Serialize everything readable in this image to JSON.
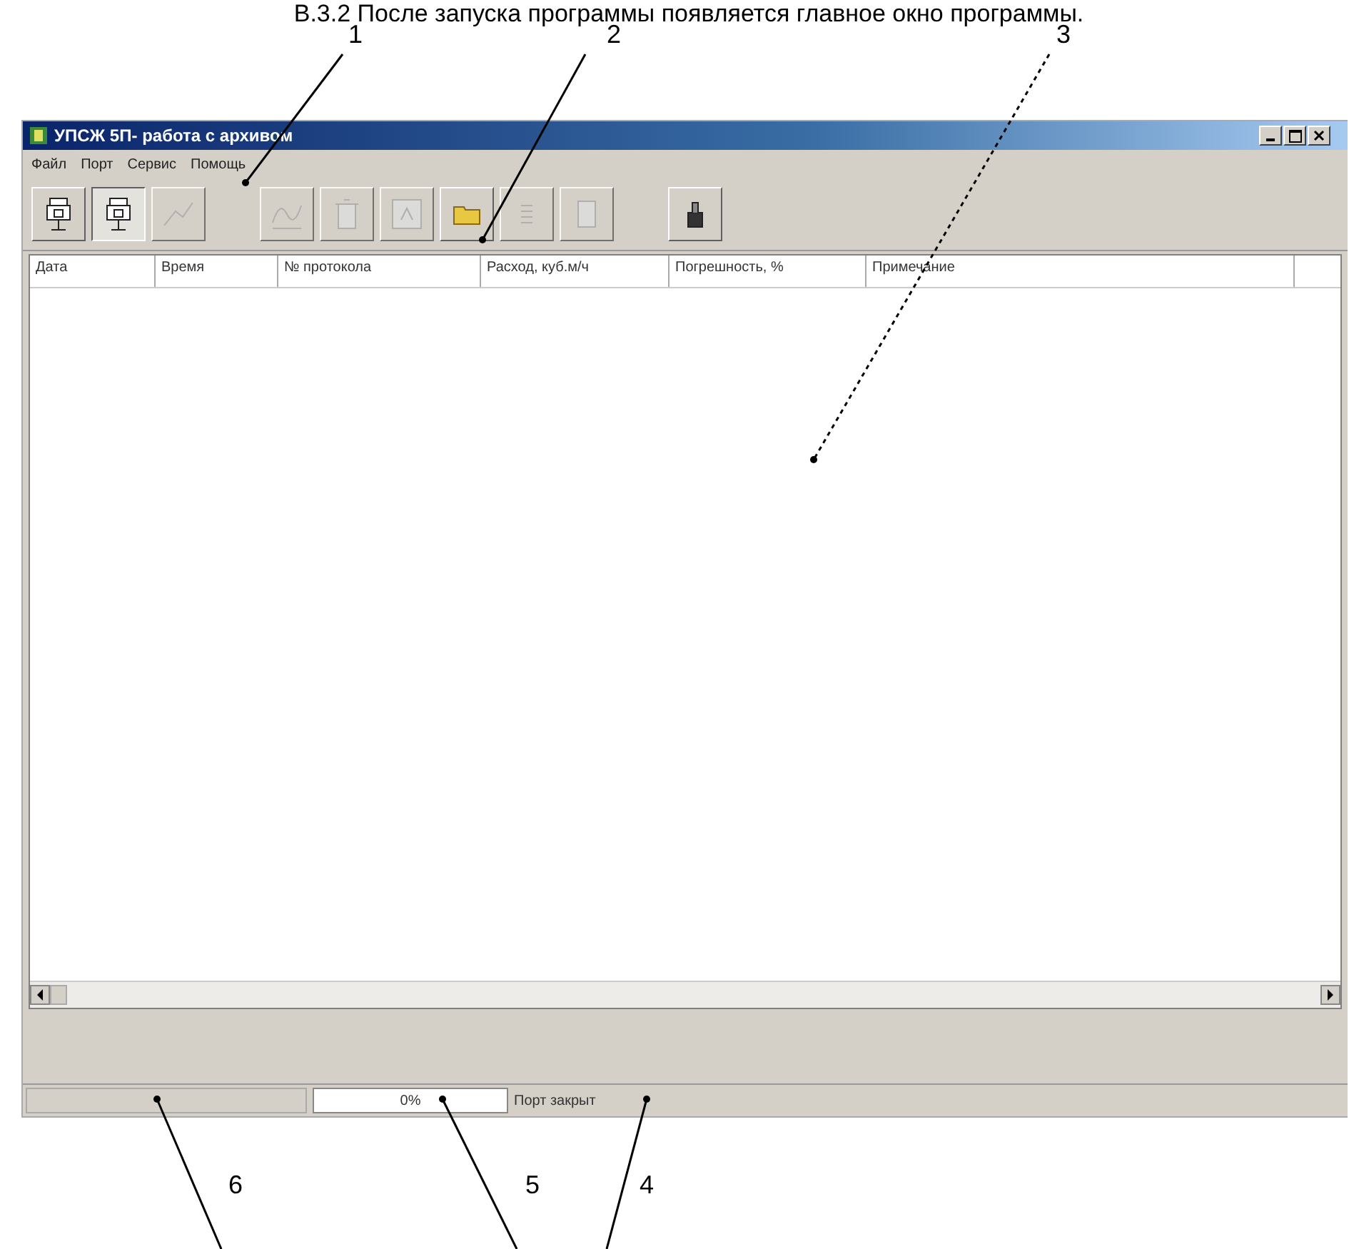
{
  "caption": "В.3.2 После запуска программы появляется главное окно программы.",
  "callouts": [
    {
      "number": "1",
      "kind": "solid"
    },
    {
      "number": "2",
      "kind": "solid"
    },
    {
      "number": "3",
      "kind": "dashed"
    },
    {
      "number": "6",
      "kind": "solid"
    },
    {
      "number": "5",
      "kind": "solid"
    },
    {
      "number": "4",
      "kind": "solid"
    }
  ],
  "window": {
    "title": "УПСЖ 5П- работа с архивом"
  },
  "menu": [
    "Файл",
    "Порт",
    "Сервис",
    "Помощь"
  ],
  "toolbar": [
    {
      "kind": "device",
      "disabled": false,
      "pressed": false
    },
    {
      "kind": "device",
      "disabled": false,
      "pressed": true
    },
    {
      "kind": "chart",
      "disabled": true,
      "pressed": false
    },
    {
      "kind": "gap"
    },
    {
      "kind": "wave",
      "disabled": true,
      "pressed": false
    },
    {
      "kind": "trash",
      "disabled": true,
      "pressed": false
    },
    {
      "kind": "frame",
      "disabled": true,
      "pressed": false
    },
    {
      "kind": "folder",
      "disabled": false,
      "pressed": false
    },
    {
      "kind": "list",
      "disabled": true,
      "pressed": false
    },
    {
      "kind": "doc",
      "disabled": true,
      "pressed": false
    },
    {
      "kind": "gap"
    },
    {
      "kind": "print",
      "disabled": false,
      "pressed": false
    }
  ],
  "table": {
    "columns": [
      "Дата",
      "Время",
      "№ протокола",
      "Расход, куб.м/ч",
      "Погрешность, %",
      "Примечание"
    ]
  },
  "status_bar": {
    "progress": {
      "text": "0%",
      "level": 0
    },
    "port": "Порт закрыт"
  }
}
